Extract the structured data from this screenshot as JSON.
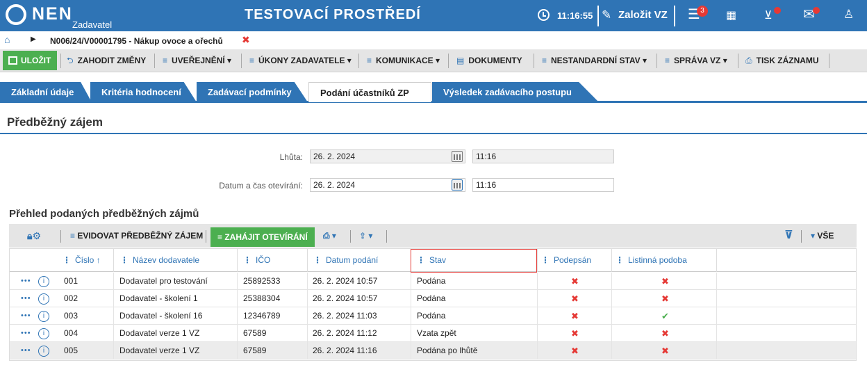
{
  "header": {
    "logo_text": "NEN",
    "logo_subtext": "Zadavatel",
    "env_title": "TESTOVACÍ PROSTŘEDÍ",
    "time": "11:16:55",
    "create_label": "Založit VZ",
    "notification_count": "3",
    "icons": [
      "clock-icon",
      "edit-icon",
      "menu-icon",
      "calculator-icon",
      "inbox-icon",
      "mail-icon",
      "user-icon"
    ]
  },
  "breadcrumb": {
    "text": "N006/24/V00001795 - Nákup ovoce a ořechů",
    "close": "✖"
  },
  "toolbar": {
    "save": "ULOŽIT",
    "discard": "ZAHODIT ZMĚNY",
    "publish": "UVEŘEJNĚNÍ",
    "actions": "ÚKONY ZADAVATELE",
    "communication": "KOMUNIKACE",
    "documents": "DOKUMENTY",
    "nonstandard": "NESTANDARDNÍ STAV",
    "manage": "SPRÁVA VZ",
    "print": "TISK ZÁZNAMU"
  },
  "tabs": [
    {
      "label": "Základní údaje",
      "active": false
    },
    {
      "label": "Kritéria hodnocení",
      "active": false
    },
    {
      "label": "Zadávací podmínky",
      "active": false
    },
    {
      "label": "Podání účastníků ZP",
      "active": true
    },
    {
      "label": "Výsledek zadávacího postupu",
      "active": false
    }
  ],
  "section": {
    "title": "Předběžný zájem",
    "deadline_label": "Lhůta:",
    "deadline_date": "26. 2. 2024",
    "deadline_time": "11:16",
    "opening_label": "Datum a čas otevírání:",
    "opening_date": "26. 2. 2024",
    "opening_time": "11:16"
  },
  "list": {
    "title": "Přehled podaných předběžných zájmů",
    "register_button": "EVIDOVAT PŘEDBĚŽNÝ ZÁJEM",
    "start_button": "ZAHÁJIT OTEVÍRÁNÍ",
    "filter_all": "VŠE",
    "columns": [
      "Číslo",
      "Název dodavatele",
      "IČO",
      "Datum podání",
      "Stav",
      "Podepsán",
      "Listinná podoba"
    ],
    "sort_indicator": "↑",
    "rows": [
      {
        "cislo": "001",
        "nazev": "Dodavatel pro testování",
        "ico": "25892533",
        "datum": "26. 2. 2024 10:57",
        "stav": "Podána",
        "podepsan": false,
        "listinna": false
      },
      {
        "cislo": "002",
        "nazev": "Dodavatel - školení 1",
        "ico": "25388304",
        "datum": "26. 2. 2024 10:57",
        "stav": "Podána",
        "podepsan": false,
        "listinna": false
      },
      {
        "cislo": "003",
        "nazev": "Dodavatel - školení 16",
        "ico": "12346789",
        "datum": "26. 2. 2024 11:03",
        "stav": "Podána",
        "podepsan": false,
        "listinna": true
      },
      {
        "cislo": "004",
        "nazev": "Dodavatel verze 1 VZ",
        "ico": "67589",
        "datum": "26. 2. 2024 11:12",
        "stav": "Vzata zpět",
        "podepsan": false,
        "listinna": false
      },
      {
        "cislo": "005",
        "nazev": "Dodavatel verze 1 VZ",
        "ico": "67589",
        "datum": "26. 2. 2024 11:16",
        "stav": "Podána po lhůtě",
        "podepsan": false,
        "listinna": false,
        "selected": true
      }
    ]
  }
}
